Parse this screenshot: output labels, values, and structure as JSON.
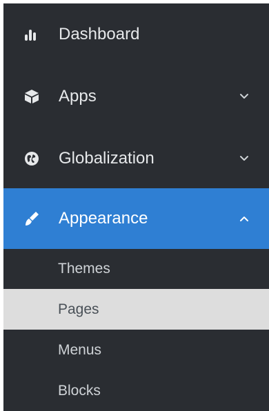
{
  "sidebar": {
    "items": [
      {
        "label": "Dashboard",
        "icon": "dashboard-bars-icon",
        "has_chevron": false
      },
      {
        "label": "Apps",
        "icon": "cube-icon",
        "has_chevron": true,
        "chevron": "chevron-down-icon"
      },
      {
        "label": "Globalization",
        "icon": "globe-icon",
        "has_chevron": true,
        "chevron": "chevron-down-icon"
      },
      {
        "label": "Appearance",
        "icon": "paint-brush-icon",
        "has_chevron": true,
        "chevron": "chevron-up-icon",
        "active": true
      }
    ],
    "subitems": [
      {
        "label": "Themes"
      },
      {
        "label": "Pages",
        "selected": true
      },
      {
        "label": "Menus"
      },
      {
        "label": "Blocks"
      }
    ]
  },
  "colors": {
    "sidebar_bg": "#2a2d32",
    "active_bg": "#2f7fd3",
    "selected_sub_bg": "#dddddd"
  }
}
